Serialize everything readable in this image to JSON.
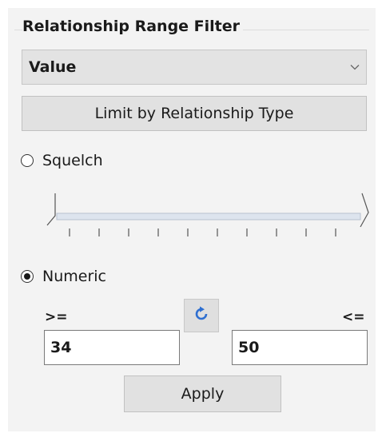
{
  "panel": {
    "title": "Relationship Range Filter",
    "dropdown": {
      "selected": "Value",
      "icon": "chevron-down-icon"
    },
    "limit_button_label": "Limit by Relationship Type",
    "squelch": {
      "label": "Squelch",
      "selected": false
    },
    "numeric": {
      "label": "Numeric",
      "selected": true
    },
    "operators": {
      "min": ">=",
      "max": "<="
    },
    "min_value": "34",
    "max_value": "50",
    "reset_icon": "refresh-icon",
    "apply_label": "Apply"
  }
}
